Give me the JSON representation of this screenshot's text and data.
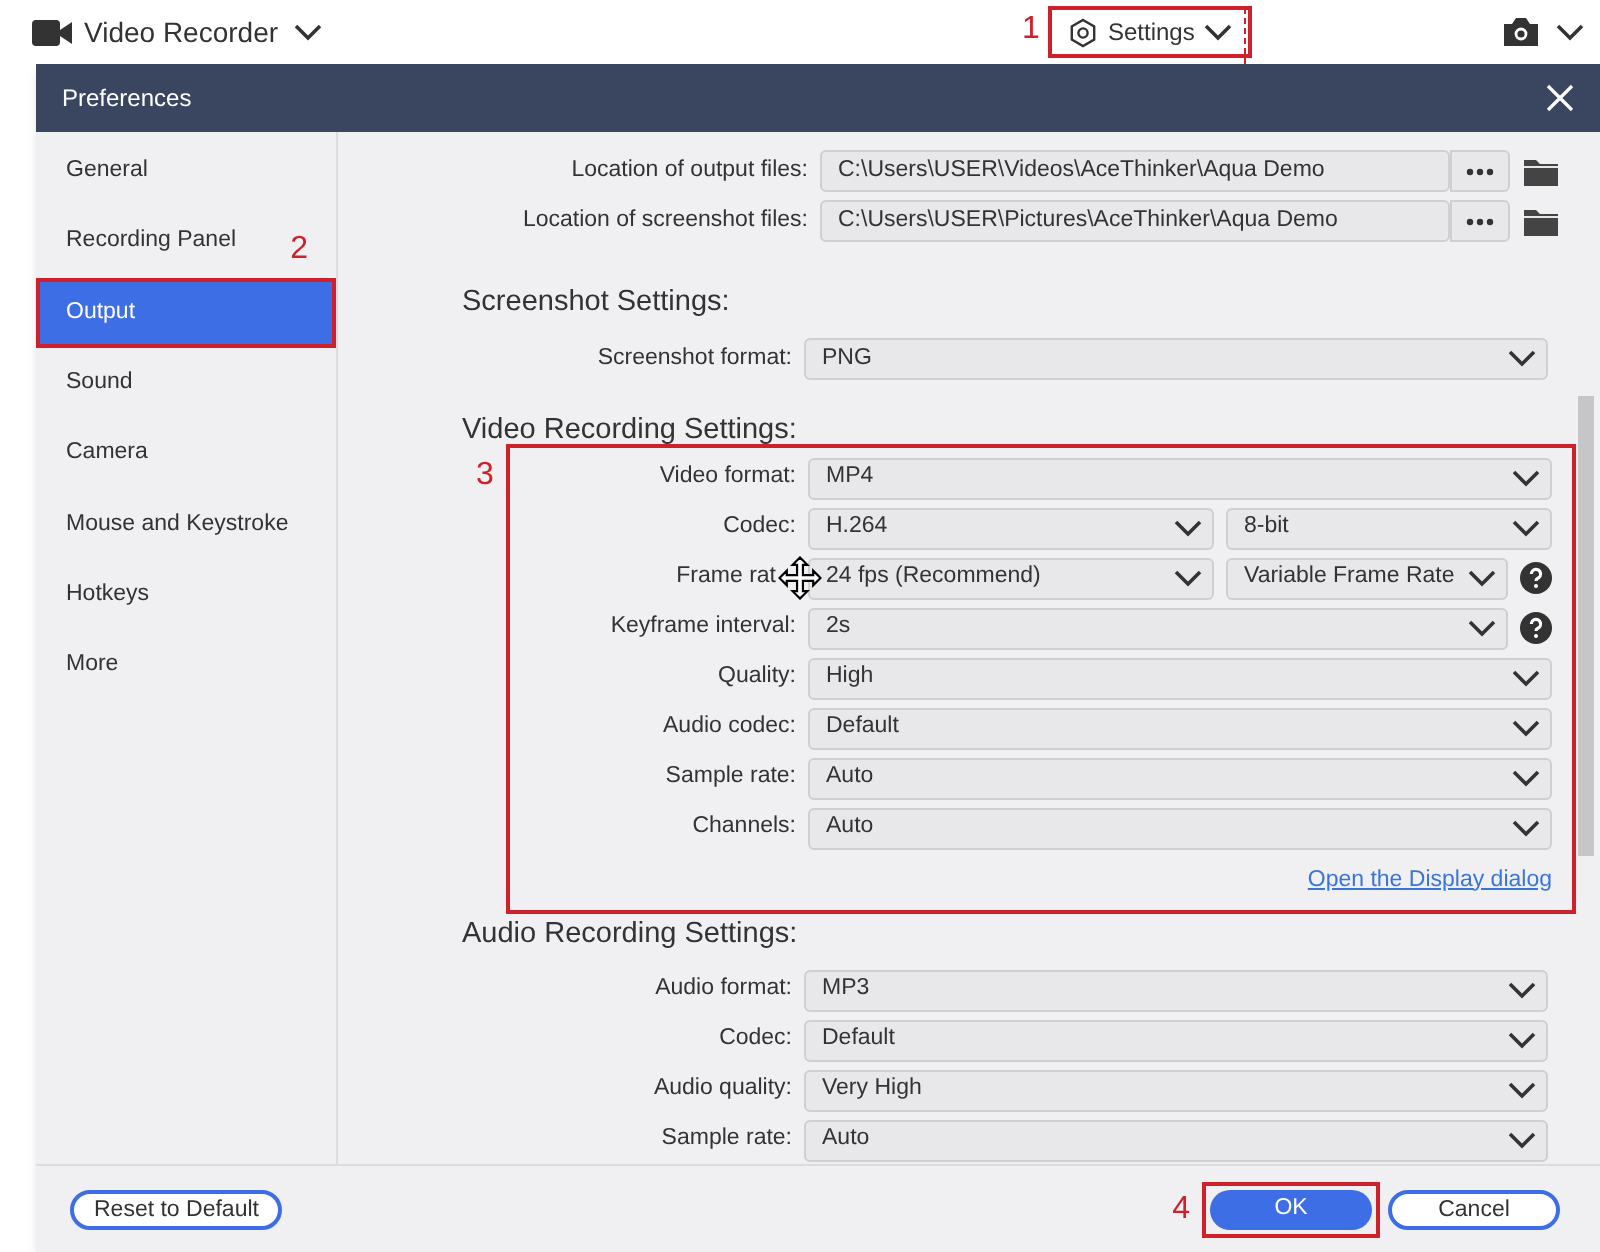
{
  "top_bar": {
    "title": "Video Recorder",
    "settings": {
      "label": "Settings",
      "highlighted": true,
      "annotation": "1"
    }
  },
  "dialog": {
    "title": "Preferences"
  },
  "sidebar": {
    "items": [
      {
        "label": "General",
        "selected": false
      },
      {
        "label": "Recording Panel",
        "selected": false,
        "annotation": "2"
      },
      {
        "label": "Output",
        "selected": true,
        "highlighted": true
      },
      {
        "label": "Sound",
        "selected": false
      },
      {
        "label": "Camera",
        "selected": false
      },
      {
        "label": "Mouse and Keystroke",
        "selected": false
      },
      {
        "label": "Hotkeys",
        "selected": false
      },
      {
        "label": "More",
        "selected": false
      }
    ]
  },
  "locations": [
    {
      "label": "Location of output files:",
      "value": "C:\\Users\\USER\\Videos\\AceThinker\\Aqua Demo"
    },
    {
      "label": "Location of screenshot files:",
      "value": "C:\\Users\\USER\\Pictures\\AceThinker\\Aqua Demo"
    }
  ],
  "sections": [
    {
      "title": "Screenshot Settings:",
      "highlighted": false,
      "rows": [
        {
          "label": "Screenshot format:",
          "values": [
            "PNG"
          ],
          "help": false
        }
      ]
    },
    {
      "title": "Video Recording Settings:",
      "highlighted": true,
      "annotation": "3",
      "link": "Open the Display dialog",
      "rows": [
        {
          "label": "Video format:",
          "values": [
            "MP4"
          ],
          "help": false
        },
        {
          "label": "Codec:",
          "values": [
            "H.264",
            "8-bit"
          ],
          "help": false
        },
        {
          "label": "Frame rat",
          "values": [
            "24 fps (Recommend)",
            "Variable Frame Rate"
          ],
          "help": true,
          "cursor": true
        },
        {
          "label": "Keyframe interval:",
          "values": [
            "2s"
          ],
          "help": true
        },
        {
          "label": "Quality:",
          "values": [
            "High"
          ],
          "help": false
        },
        {
          "label": "Audio codec:",
          "values": [
            "Default"
          ],
          "help": false
        },
        {
          "label": "Sample rate:",
          "values": [
            "Auto"
          ],
          "help": false
        },
        {
          "label": "Channels:",
          "values": [
            "Auto"
          ],
          "help": false
        }
      ]
    },
    {
      "title": "Audio Recording Settings:",
      "highlighted": false,
      "rows": [
        {
          "label": "Audio format:",
          "values": [
            "MP3"
          ],
          "help": false
        },
        {
          "label": "Codec:",
          "values": [
            "Default"
          ],
          "help": false
        },
        {
          "label": "Audio quality:",
          "values": [
            "Very High"
          ],
          "help": false
        },
        {
          "label": "Sample rate:",
          "values": [
            "Auto"
          ],
          "help": false
        }
      ]
    }
  ],
  "footer": {
    "reset": "Reset to Default",
    "ok": {
      "label": "OK",
      "highlighted": true,
      "annotation": "4"
    },
    "cancel": "Cancel"
  }
}
